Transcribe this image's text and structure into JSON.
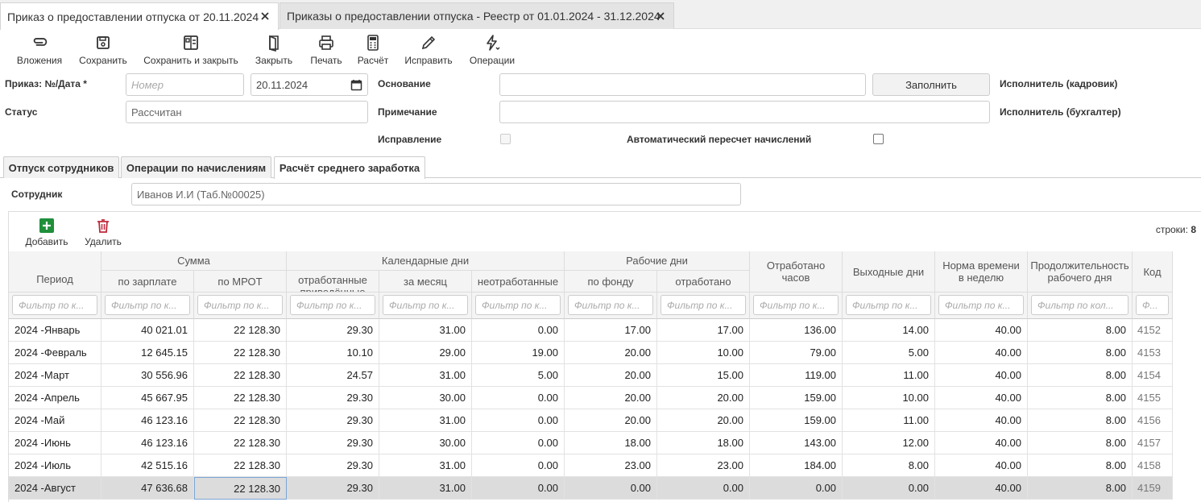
{
  "tabs": [
    {
      "label": "Приказ о предоставлении отпуска от 20.11.2024",
      "active": true
    },
    {
      "label": "Приказы о предоставлении отпуска - Реестр от 01.01.2024 - 31.12.2024",
      "active": false
    }
  ],
  "toolbar": {
    "attachments": "Вложения",
    "save": "Сохранить",
    "save_close": "Сохранить и закрыть",
    "close": "Закрыть",
    "print": "Печать",
    "calc": "Расчёт",
    "fix": "Исправить",
    "operations": "Операции"
  },
  "form": {
    "order_label": "Приказ: №/Дата *",
    "number_placeholder": "Номер",
    "date": "20.11.2024",
    "status_label": "Статус",
    "status_value": "Рассчитан",
    "basis_label": "Основание",
    "fill_button": "Заполнить",
    "note_label": "Примечание",
    "correction_label": "Исправление",
    "auto_recalc_label": "Автоматический пересчет начислений",
    "executor_hr": "Исполнитель (кадровик)",
    "executor_acc": "Исполнитель (бухгалтер)"
  },
  "inner_tabs": [
    {
      "label": "Отпуск сотрудников"
    },
    {
      "label": "Операции по начислениям"
    },
    {
      "label": "Расчёт среднего заработка"
    }
  ],
  "employee": {
    "label": "Сотрудник",
    "value": "Иванов И.И (Таб.№00025)"
  },
  "grid": {
    "add": "Добавить",
    "delete": "Удалить",
    "rows_label": "строки:",
    "rows_count": "8",
    "groups": {
      "sum": "Сумма",
      "calendar": "Календарные дни",
      "work": "Рабочие дни"
    },
    "columns": [
      {
        "label": "Период",
        "filter": ""
      },
      {
        "label": "по зарплате",
        "filter": "Фильтр по к..."
      },
      {
        "label": "по МРОТ",
        "filter": "Фильтр по к..."
      },
      {
        "label": "отработанные приведённые",
        "filter": "Фильтр по к..."
      },
      {
        "label": "за месяц",
        "filter": "Фильтр по к..."
      },
      {
        "label": "неотработанные",
        "filter": "Фильтр по к..."
      },
      {
        "label": "по фонду",
        "filter": "Фильтр по к..."
      },
      {
        "label": "отработано",
        "filter": "Фильтр по к..."
      },
      {
        "label": "Отработано часов",
        "filter": "Фильтр по к..."
      },
      {
        "label": "Выходные дни",
        "filter": "Фильтр по к..."
      },
      {
        "label": "Норма времени в неделю",
        "filter": "Фильтр по к..."
      },
      {
        "label": "Продолжительность рабочего дня",
        "filter": "Фильтр по кол..."
      },
      {
        "label": "Код",
        "filter": "Ф..."
      }
    ],
    "period_filter": "Фильтр по к...",
    "rows": [
      [
        "2024 -Январь",
        "40 021.01",
        "22 128.30",
        "29.30",
        "31.00",
        "0.00",
        "17.00",
        "17.00",
        "136.00",
        "14.00",
        "40.00",
        "8.00",
        "4152"
      ],
      [
        "2024 -Февраль",
        "12 645.15",
        "22 128.30",
        "10.10",
        "29.00",
        "19.00",
        "20.00",
        "10.00",
        "79.00",
        "5.00",
        "40.00",
        "8.00",
        "4153"
      ],
      [
        "2024 -Март",
        "30 556.96",
        "22 128.30",
        "24.57",
        "31.00",
        "5.00",
        "20.00",
        "15.00",
        "119.00",
        "11.00",
        "40.00",
        "8.00",
        "4154"
      ],
      [
        "2024 -Апрель",
        "45 667.95",
        "22 128.30",
        "29.30",
        "30.00",
        "0.00",
        "20.00",
        "20.00",
        "159.00",
        "10.00",
        "40.00",
        "8.00",
        "4155"
      ],
      [
        "2024 -Май",
        "46 123.16",
        "22 128.30",
        "29.30",
        "31.00",
        "0.00",
        "20.00",
        "20.00",
        "159.00",
        "11.00",
        "40.00",
        "8.00",
        "4156"
      ],
      [
        "2024 -Июнь",
        "46 123.16",
        "22 128.30",
        "29.30",
        "30.00",
        "0.00",
        "18.00",
        "18.00",
        "143.00",
        "12.00",
        "40.00",
        "8.00",
        "4157"
      ],
      [
        "2024 -Июль",
        "42 515.16",
        "22 128.30",
        "29.30",
        "31.00",
        "0.00",
        "23.00",
        "23.00",
        "184.00",
        "8.00",
        "40.00",
        "8.00",
        "4158"
      ],
      [
        "2024 -Август",
        "47 636.68",
        "22 128.30",
        "29.30",
        "31.00",
        "0.00",
        "0.00",
        "0.00",
        "0.00",
        "0.00",
        "40.00",
        "8.00",
        "4159"
      ]
    ]
  },
  "colors": {
    "add_green": "#1f8f3a",
    "delete_red": "#c0283a",
    "selected_row": "#dcdcdc",
    "focus_border": "#7aa6d6"
  }
}
